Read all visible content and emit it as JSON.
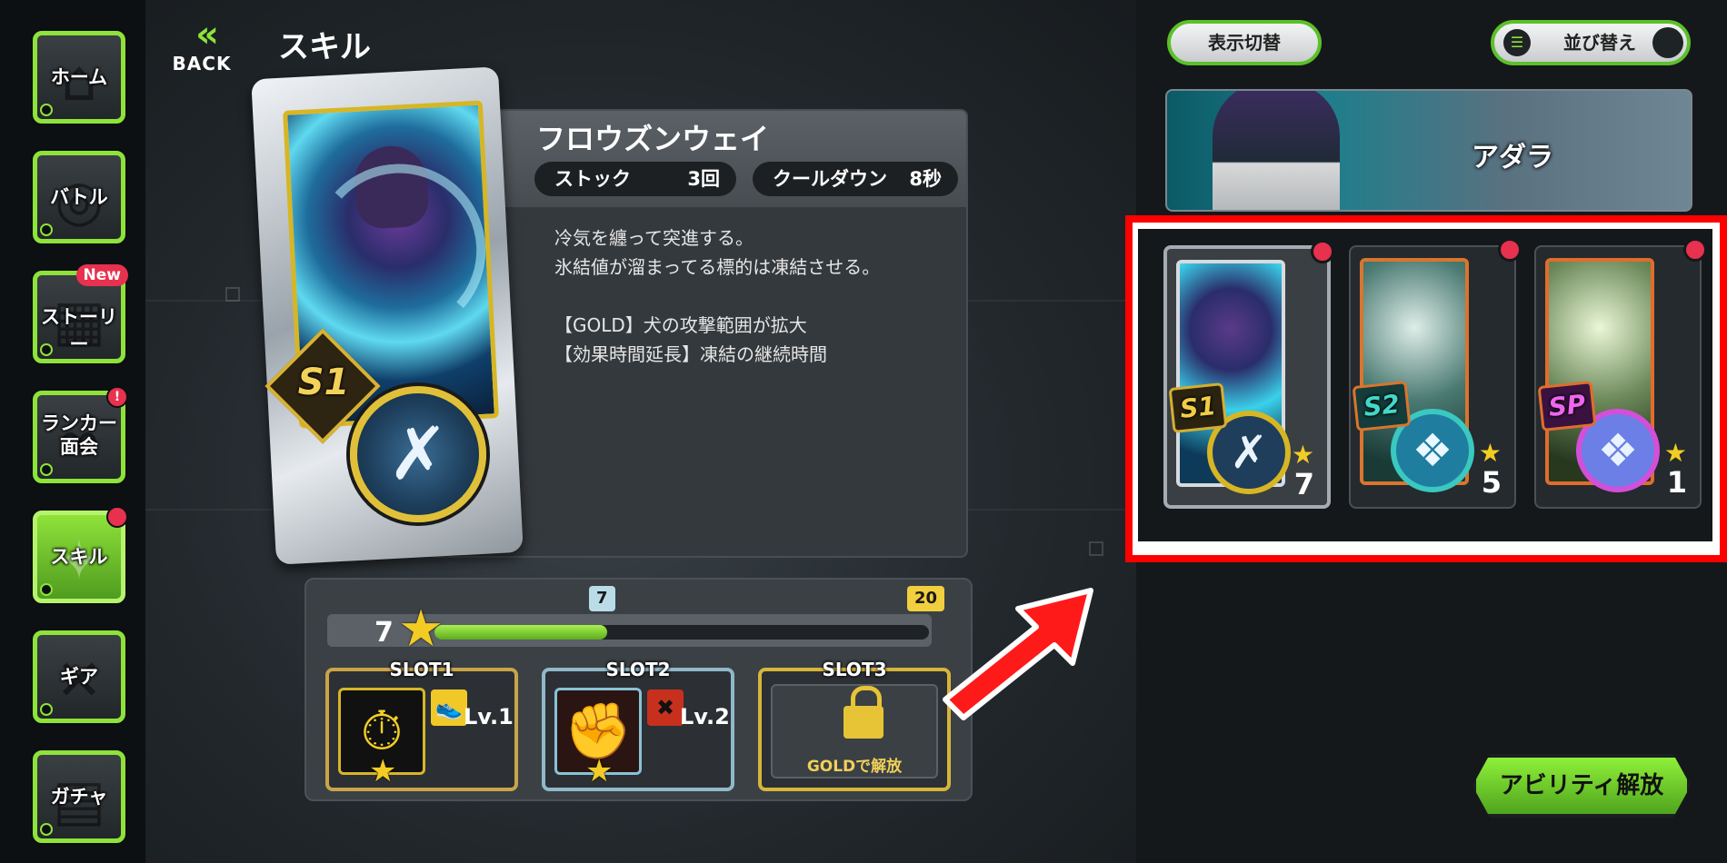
{
  "sidebar": {
    "items": [
      {
        "label": "ホーム",
        "icon": "home-icon"
      },
      {
        "label": "バトル",
        "icon": "battle-icon"
      },
      {
        "label": "ストーリー",
        "icon": "film-icon",
        "badge": "New"
      },
      {
        "label": "ランカー\n面会",
        "icon": "chain-icon",
        "badge": "!"
      },
      {
        "label": "スキル",
        "icon": "sparkle-icon",
        "active": true
      },
      {
        "label": "ギア",
        "icon": "wrench-icon"
      },
      {
        "label": "ガチャ",
        "icon": "gacha-icon"
      }
    ]
  },
  "header": {
    "back_label": "BACK",
    "title": "スキル"
  },
  "skill": {
    "name": "フロウズンウェイ",
    "stock_label": "ストック",
    "stock_value": "3回",
    "cooldown_label": "クールダウン",
    "cooldown_value": "8秒",
    "badge": "S1",
    "description": [
      "冷気を纏って突進する。",
      "氷結値が溜まってる標的は凍結させる。"
    ],
    "effects": [
      "【GOLD】犬の攻撃範囲が拡大",
      "【効果時間延長】凍結の継続時間"
    ]
  },
  "progress": {
    "level": "7",
    "current_marker": "7",
    "max_marker": "20",
    "fraction": 0.35
  },
  "slots": [
    {
      "title": "SLOT1",
      "level": "Lv.1"
    },
    {
      "title": "SLOT2",
      "level": "Lv.2"
    },
    {
      "title": "SLOT3",
      "locked_text": "GOLDで解放"
    }
  ],
  "right": {
    "display_toggle_label": "表示切替",
    "sort_label": "並び替え",
    "character_name": "アダラ",
    "skill_cards": [
      {
        "tag": "S1",
        "count": "7"
      },
      {
        "tag": "S2",
        "count": "5"
      },
      {
        "tag": "SP",
        "count": "1"
      }
    ],
    "ability_button_label": "アビリティ解放"
  },
  "colors": {
    "accent": "#8de33a",
    "highlight": "#ff0000",
    "badge": "#e8304f",
    "gold": "#f2cc22"
  }
}
